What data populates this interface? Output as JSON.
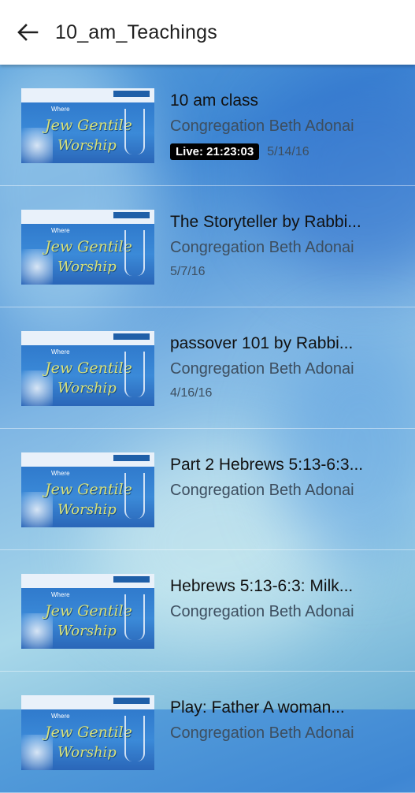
{
  "appbar": {
    "title": "10_am_Teachings"
  },
  "thumbnail": {
    "where": "Where",
    "line1": "Jew Gentile",
    "line2": "Worship"
  },
  "items": [
    {
      "title": "10 am class",
      "owner": "Congregation Beth Adonai",
      "badge": "Live: 21:23:03",
      "date": "5/14/16"
    },
    {
      "title": "The Storyteller by Rabbi...",
      "owner": "Congregation Beth Adonai",
      "badge": "",
      "date": "5/7/16"
    },
    {
      "title": "passover 101 by Rabbi...",
      "owner": "Congregation Beth Adonai",
      "badge": "",
      "date": "4/16/16"
    },
    {
      "title": "Part 2 Hebrews 5:13-6:3...",
      "owner": "Congregation Beth Adonai",
      "badge": "",
      "date": ""
    },
    {
      "title": "Hebrews 5:13-6:3:  Milk...",
      "owner": "Congregation Beth Adonai",
      "badge": "",
      "date": ""
    },
    {
      "title": "Play: Father A woman...",
      "owner": "Congregation Beth Adonai",
      "badge": "",
      "date": ""
    }
  ]
}
